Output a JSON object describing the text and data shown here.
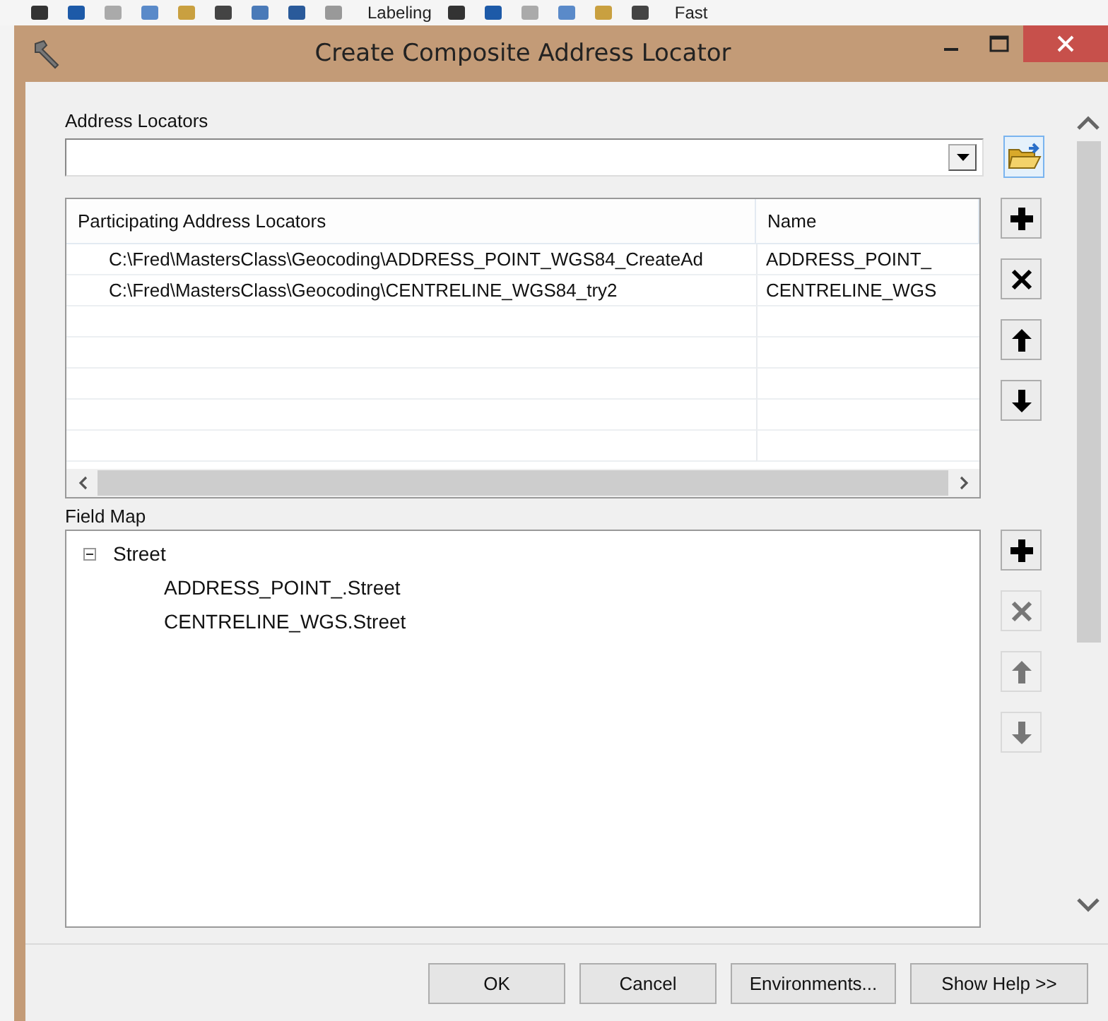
{
  "background_toolbar": {
    "items": [
      {
        "kind": "icon"
      },
      {
        "kind": "icon"
      },
      {
        "kind": "icon"
      },
      {
        "kind": "icon"
      },
      {
        "kind": "icon"
      },
      {
        "kind": "icon"
      },
      {
        "kind": "icon"
      },
      {
        "kind": "icon"
      },
      {
        "kind": "icon"
      },
      {
        "kind": "text",
        "label": "Labeling"
      },
      {
        "kind": "icon"
      },
      {
        "kind": "icon"
      },
      {
        "kind": "icon"
      },
      {
        "kind": "icon"
      },
      {
        "kind": "icon"
      },
      {
        "kind": "icon"
      },
      {
        "kind": "text",
        "label": "Fast"
      }
    ]
  },
  "window": {
    "title": "Create Composite Address Locator"
  },
  "address_locators": {
    "label": "Address Locators"
  },
  "table": {
    "columns": [
      "Participating Address Locators",
      "Name"
    ],
    "rows": [
      [
        "C:\\Fred\\MastersClass\\Geocoding\\ADDRESS_POINT_WGS84_CreateAd",
        "ADDRESS_POINT_"
      ],
      [
        "C:\\Fred\\MastersClass\\Geocoding\\CENTRELINE_WGS84_try2",
        "CENTRELINE_WGS"
      ]
    ]
  },
  "table_buttons": [
    {
      "kind": "add",
      "disabled": false
    },
    {
      "kind": "remove",
      "disabled": false
    },
    {
      "kind": "up",
      "disabled": false
    },
    {
      "kind": "down",
      "disabled": false
    }
  ],
  "field_map": {
    "label": "Field Map",
    "tree": [
      {
        "label": "Street",
        "expanded": true,
        "children": [
          {
            "label": "ADDRESS_POINT_.Street"
          },
          {
            "label": "CENTRELINE_WGS.Street"
          }
        ]
      }
    ]
  },
  "field_map_buttons": [
    {
      "kind": "add",
      "disabled": false
    },
    {
      "kind": "remove",
      "disabled": true
    },
    {
      "kind": "up",
      "disabled": true
    },
    {
      "kind": "down",
      "disabled": true
    }
  ],
  "buttons": [
    "OK",
    "Cancel",
    "Environments...",
    "Show Help >>"
  ]
}
